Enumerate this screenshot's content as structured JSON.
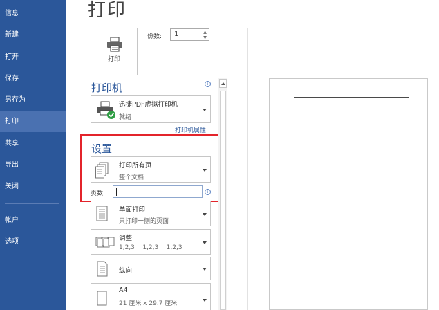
{
  "sidebar": {
    "items": [
      {
        "label": "信息"
      },
      {
        "label": "新建"
      },
      {
        "label": "打开"
      },
      {
        "label": "保存"
      },
      {
        "label": "另存为"
      },
      {
        "label": "打印"
      },
      {
        "label": "共享"
      },
      {
        "label": "导出"
      },
      {
        "label": "关闭"
      },
      {
        "label": "帐户"
      },
      {
        "label": "选项"
      }
    ],
    "active": "打印",
    "bg_color": "#2b579a",
    "active_color": "#4a71b1"
  },
  "page": {
    "title": "打印"
  },
  "print_button": {
    "label": "打印",
    "icon": "printer-icon"
  },
  "copies": {
    "label": "份数:",
    "value": "1"
  },
  "printer": {
    "heading": "打印机",
    "name": "迅捷PDF虚拟打印机",
    "status": "就绪",
    "properties_link": "打印机属性",
    "icon": "printer-ready-icon"
  },
  "settings": {
    "heading": "设置",
    "range": {
      "title": "打印所有页",
      "sub": "整个文档"
    },
    "pages_label": "页数:",
    "pages_value": "",
    "sides": {
      "title": "单面打印",
      "sub": "只打印一侧的页面"
    },
    "collate": {
      "title": "调整",
      "sub": "1,2,3    1,2,3    1,2,3"
    },
    "orientation": {
      "title": "纵向"
    },
    "paper": {
      "title": "A4",
      "sub": "21 厘米 x 29.7 厘米"
    }
  },
  "colors": {
    "accent": "#2b579a",
    "highlight": "#e3242b"
  }
}
